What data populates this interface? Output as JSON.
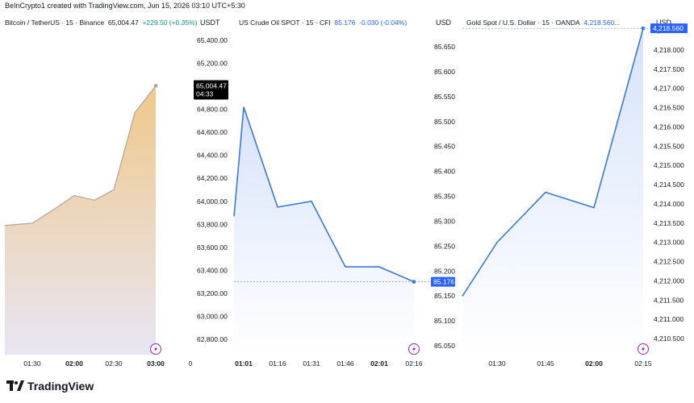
{
  "header": {
    "credit": "BeInCrypto1 created with TradingView.com, Jun 15, 2026 03:10 UTC+5:30"
  },
  "footer": {
    "brand": "TradingView"
  },
  "chart_data": [
    {
      "type": "area",
      "symbol": "Bitcoin / TetherUS · 15 · Binance",
      "price": "65,004.47",
      "change": "+229.50 (+0.35%)",
      "unit": "USDT",
      "colors": {
        "line": "#b0a59c",
        "fill_top": "#f0c88a",
        "fill_bottom": "#e8e6f4",
        "change": "#089981"
      },
      "y_ticks": [
        62800,
        63000,
        63200,
        63400,
        63600,
        63800,
        64000,
        64200,
        64400,
        64600,
        64800,
        65000,
        65200,
        65400
      ],
      "y_tick_labels": [
        "62,800.00",
        "63,000.00",
        "63,200.00",
        "63,400.00",
        "63,600.00",
        "63,800.00",
        "64,000.00",
        "64,200.00",
        "64,400.00",
        "64,600.00",
        "64,800.00",
        "65,000.00",
        "65,200.00",
        "65,400.00"
      ],
      "ylim": [
        62650,
        65560
      ],
      "x_ticks": [
        "01:30",
        "02:00",
        "02:30",
        "03:00",
        "0"
      ],
      "x_bold": [
        "02:00",
        "03:00"
      ],
      "x": [
        "01:15",
        "01:30",
        "01:45",
        "02:00",
        "02:15",
        "02:30",
        "02:45",
        "03:00"
      ],
      "values": [
        63790,
        63810,
        63930,
        64050,
        64010,
        64100,
        64770,
        65004.47
      ],
      "last_label": {
        "price": "65,004.47",
        "countdown": "04:33"
      }
    },
    {
      "type": "area",
      "symbol": "US Crude Oil SPOT · 15 · CFI",
      "price": "85.176",
      "change": "-0.030 (-0.04%)",
      "unit": "USD",
      "colors": {
        "line": "#3d78d8",
        "fill_top": "#dbe6fb",
        "fill_bottom": "#ffffff",
        "change": "#2962ff"
      },
      "y_ticks": [
        85.05,
        85.1,
        85.15,
        85.2,
        85.25,
        85.3,
        85.35,
        85.4,
        85.45,
        85.5,
        85.55,
        85.6,
        85.65
      ],
      "y_tick_labels": [
        "85.050",
        "85.100",
        "85.150",
        "85.200",
        "85.250",
        "85.300",
        "85.350",
        "85.400",
        "85.450",
        "85.500",
        "85.550",
        "85.600",
        "85.650"
      ],
      "ylim": [
        85.025,
        85.685
      ],
      "x_ticks": [
        "01:01",
        "01:16",
        "01:31",
        "01:46",
        "02:01",
        "02:16"
      ],
      "x_bold": [
        "01:01",
        "02:01"
      ],
      "x": [
        "00:55",
        "01:01",
        "01:16",
        "01:31",
        "01:46",
        "02:01",
        "02:16"
      ],
      "values": [
        63870,
        64820,
        63950,
        64000,
        63430,
        63430,
        63300
      ],
      "values_axis": "bitcoin-scaled",
      "last_label": {
        "price": "85.176"
      }
    },
    {
      "type": "area",
      "symbol": "Gold Spot / U.S. Dollar · 15 · OANDA",
      "price": "4,218.560...",
      "change": "",
      "unit": "USD",
      "colors": {
        "line": "#3d78d8",
        "fill_top": "#dbe6fb",
        "fill_bottom": "#ffffff",
        "change": "#2962ff"
      },
      "y_ticks": [
        4210.5,
        4211,
        4211.5,
        4212,
        4212.5,
        4213,
        4213.5,
        4214,
        4214.5,
        4215,
        4215.5,
        4216,
        4216.5,
        4217,
        4217.5,
        4218,
        4218.5
      ],
      "y_tick_labels": [
        "4,210.500",
        "4,211.000",
        "4,211.500",
        "4,212.000",
        "4,212.500",
        "4,213.000",
        "4,213.500",
        "4,214.000",
        "4,214.500",
        "4,215.000",
        "4,215.500",
        "4,216.000",
        "4,216.500",
        "4,217.000",
        "4,217.500",
        "4,218.000",
        "4,218.500"
      ],
      "ylim": [
        4210.3,
        4218.9
      ],
      "x_ticks": [
        "01:30",
        "01:45",
        "02:00",
        "02:15"
      ],
      "x_bold": [
        "02:00"
      ],
      "x": [
        "01:15",
        "01:30",
        "01:45",
        "02:00",
        "02:15"
      ],
      "values": [
        4211.6,
        4213.0,
        4214.3,
        4213.9,
        4218.56
      ],
      "last_label": {
        "price": "4,218.560"
      }
    }
  ]
}
